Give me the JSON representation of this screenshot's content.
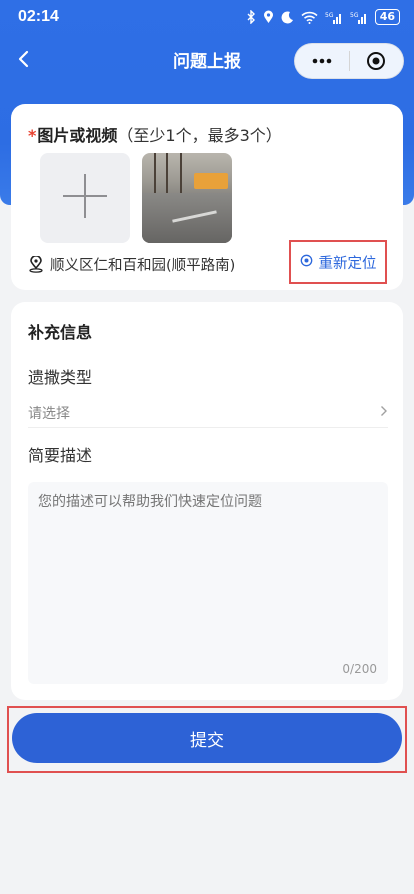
{
  "status_bar": {
    "time": "02:14",
    "battery": "46",
    "icons": [
      "bluetooth-icon",
      "location-icon",
      "moon-icon",
      "wifi-icon",
      "signal-icon",
      "signal-icon",
      "battery-icon"
    ]
  },
  "nav": {
    "title": "问题上报",
    "back_icon": "chevron-left-icon",
    "more_icon": "more-dots-icon",
    "close_icon": "circle-target-icon"
  },
  "media_card": {
    "required_mark": "*",
    "title": "图片或视频",
    "hint": "（至少1个，最多3个）",
    "add_icon": "plus-icon",
    "location_icon": "location-pin-icon",
    "location_text": "顺义区仁和百和园(顺平路南)",
    "relocate_icon": "target-icon",
    "relocate_label": "重新定位"
  },
  "info_card": {
    "title": "补充信息",
    "type_label": "遗撒类型",
    "type_placeholder": "请选择",
    "desc_label": "简要描述",
    "desc_placeholder": "您的描述可以帮助我们快速定位问题",
    "counter": "0/200"
  },
  "submit": {
    "label": "提交"
  },
  "colors": {
    "primary": "#2d62d6",
    "header": "#2f6fe6",
    "highlight_border": "#e05050",
    "required": "#e8412f"
  }
}
